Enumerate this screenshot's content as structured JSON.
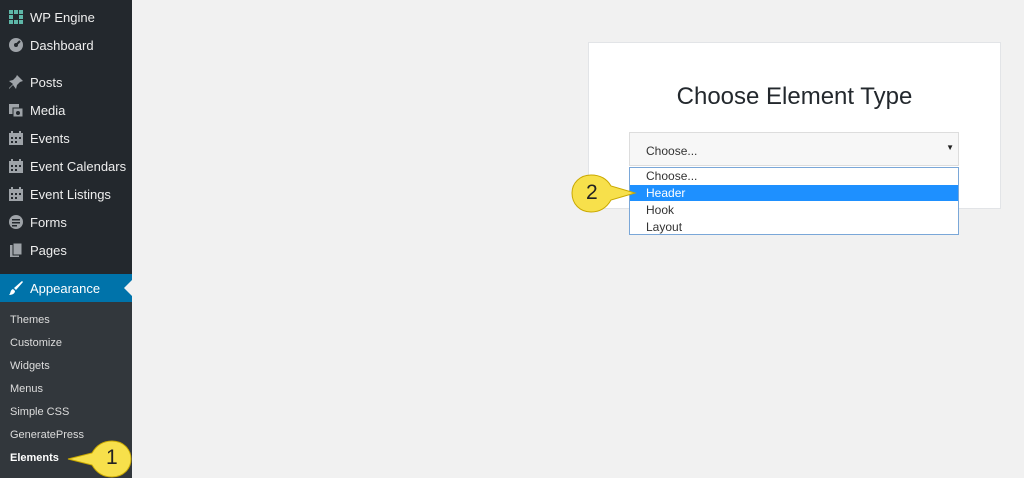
{
  "sidebar": {
    "items": [
      {
        "label": "WP Engine",
        "icon": "wp-engine-icon"
      },
      {
        "label": "Dashboard",
        "icon": "dashboard-icon"
      },
      {
        "label": "Posts",
        "icon": "pin-icon"
      },
      {
        "label": "Media",
        "icon": "media-icon"
      },
      {
        "label": "Events",
        "icon": "calendar-icon"
      },
      {
        "label": "Event Calendars",
        "icon": "calendar-icon"
      },
      {
        "label": "Event Listings",
        "icon": "calendar-icon"
      },
      {
        "label": "Forms",
        "icon": "forms-icon"
      },
      {
        "label": "Pages",
        "icon": "pages-icon"
      },
      {
        "label": "Appearance",
        "icon": "paintbrush-icon"
      }
    ],
    "submenu": [
      "Themes",
      "Customize",
      "Widgets",
      "Menus",
      "Simple CSS",
      "GeneratePress",
      "Elements"
    ]
  },
  "card": {
    "title": "Choose Element Type",
    "select_value": "Choose...",
    "options": [
      "Choose...",
      "Header",
      "Hook",
      "Layout"
    ],
    "highlighted_option": "Header"
  },
  "callouts": {
    "one": "1",
    "two": "2"
  },
  "colors": {
    "sidebar": "#23282d",
    "active": "#0073aa",
    "highlight": "#1e90ff",
    "callout": "#f7e04b"
  }
}
